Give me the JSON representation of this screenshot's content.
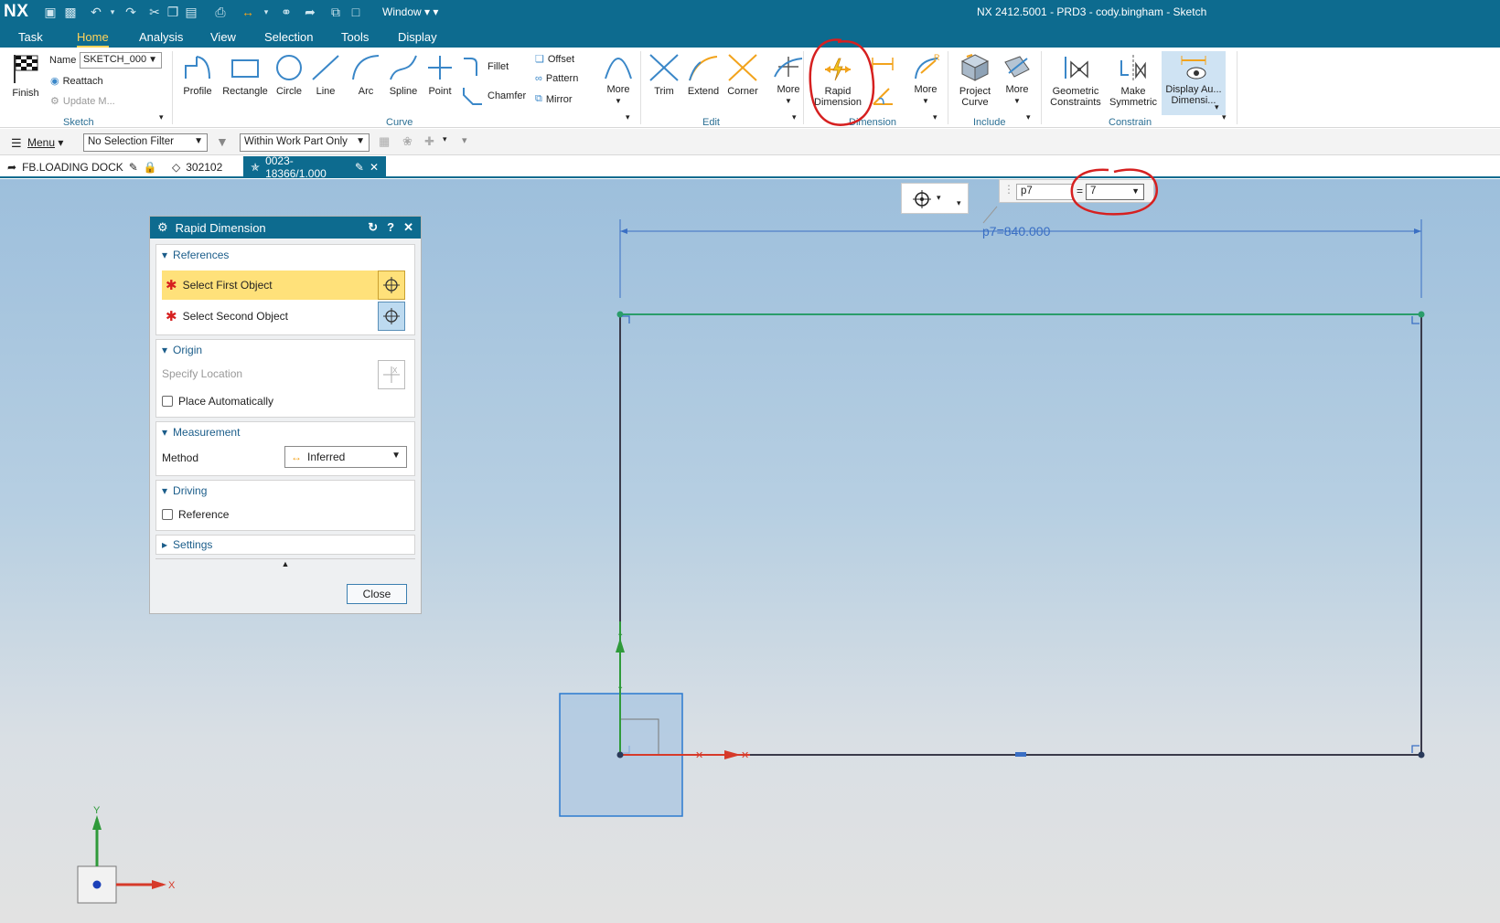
{
  "app": {
    "logo": "NX",
    "window_menu": "Window",
    "window_title": "NX 2412.5001 - PRD3 - cody.bingham - Sketch"
  },
  "menu_tabs": [
    "Task",
    "Home",
    "Analysis",
    "View",
    "Selection",
    "Tools",
    "Display"
  ],
  "active_tab": "Home",
  "ribbon": {
    "finish": "Finish",
    "name_label": "Name",
    "name_value": "SKETCH_000",
    "reattach": "Reattach",
    "update_model": "Update M...",
    "group_sketch": "Sketch",
    "curve_tools": [
      "Profile",
      "Rectangle",
      "Circle",
      "Line",
      "Arc",
      "Spline",
      "Point"
    ],
    "fillet": "Fillet",
    "chamfer": "Chamfer",
    "offset": "Offset",
    "pattern": "Pattern",
    "mirror": "Mirror",
    "more_curve": "More",
    "group_curve": "Curve",
    "edit_tools": [
      "Trim",
      "Extend",
      "Corner"
    ],
    "more_edit": "More",
    "group_edit": "Edit",
    "rapid_dimension": "Rapid Dimension",
    "more_dim": "More",
    "group_dimension": "Dimension",
    "project_curve": "Project Curve",
    "more_include": "More",
    "group_include": "Include",
    "geometric_constraints": "Geometric Constraints",
    "make_symmetric": "Make Symmetric",
    "display_auto_dim": "Display Au... Dimensi...",
    "group_constrain": "Constrain"
  },
  "toolbar": {
    "menu": "Menu",
    "selection_filter": "No Selection Filter",
    "scope": "Within Work Part Only"
  },
  "doc_tabs": [
    {
      "label": "FB.LOADING DOCK"
    },
    {
      "label": "302102"
    },
    {
      "label": "0023-18366/1.000"
    }
  ],
  "dialog": {
    "title": "Rapid Dimension",
    "references": "References",
    "select_first": "Select First Object",
    "select_second": "Select Second Object",
    "origin": "Origin",
    "specify_location": "Specify Location",
    "place_auto": "Place Automatically",
    "measurement": "Measurement",
    "method_label": "Method",
    "method_value": "Inferred",
    "driving": "Driving",
    "reference": "Reference",
    "settings": "Settings",
    "close": "Close"
  },
  "onscreen_input": {
    "name": "p7",
    "equals": "=",
    "value": "7"
  },
  "sketch": {
    "dimension_label": "p7=840.000"
  },
  "triad": {
    "x": "X",
    "y": "Y"
  },
  "colors": {
    "nx_blue": "#0d6b8f",
    "highlight_yellow": "#ffe17a",
    "annotation_red": "#d62020",
    "dimension_blue": "#3a6fc4",
    "constrained_green": "#2a9d6a",
    "sketch_curve": "#3a3a4a"
  }
}
